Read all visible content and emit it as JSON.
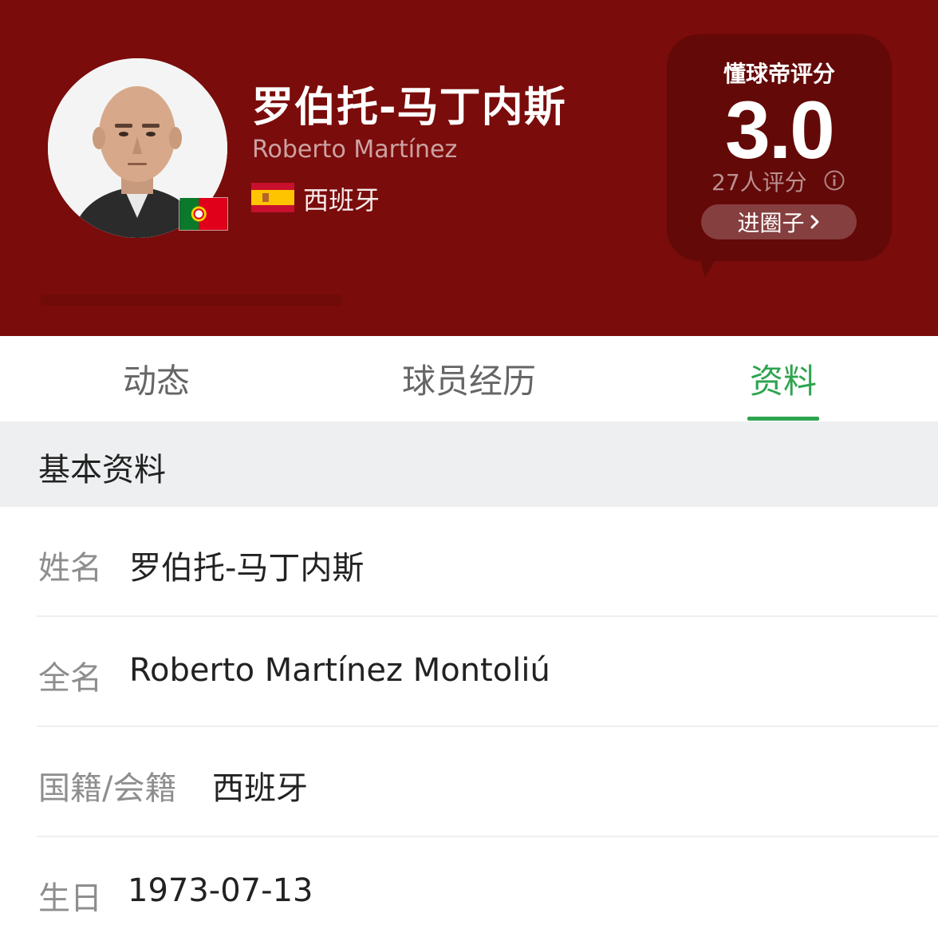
{
  "header": {
    "name_cn": "罗伯托-马丁内斯",
    "name_en": "Roberto Martínez",
    "nationality": "西班牙",
    "avatar_flag": "portugal-flag",
    "nation_flag": "spain-flag",
    "background_color": "#7a0c0b"
  },
  "rating": {
    "title": "懂球帝评分",
    "score": "3.0",
    "count_text": "27人评分",
    "info_icon": "info-icon",
    "enter_label": "进圈子",
    "enter_icon": "chevron-right-icon"
  },
  "tabs": [
    {
      "label": "动态",
      "active": false
    },
    {
      "label": "球员经历",
      "active": false
    },
    {
      "label": "资料",
      "active": true
    }
  ],
  "accent_color": "#2ea44f",
  "section": {
    "title": "基本资料",
    "rows": [
      {
        "label": "姓名",
        "value": "罗伯托-马丁内斯"
      },
      {
        "label": "全名",
        "value": "Roberto Martínez Montoliú"
      },
      {
        "label": "国籍/会籍",
        "value": "西班牙"
      },
      {
        "label": "生日",
        "value": "1973-07-13"
      }
    ]
  }
}
